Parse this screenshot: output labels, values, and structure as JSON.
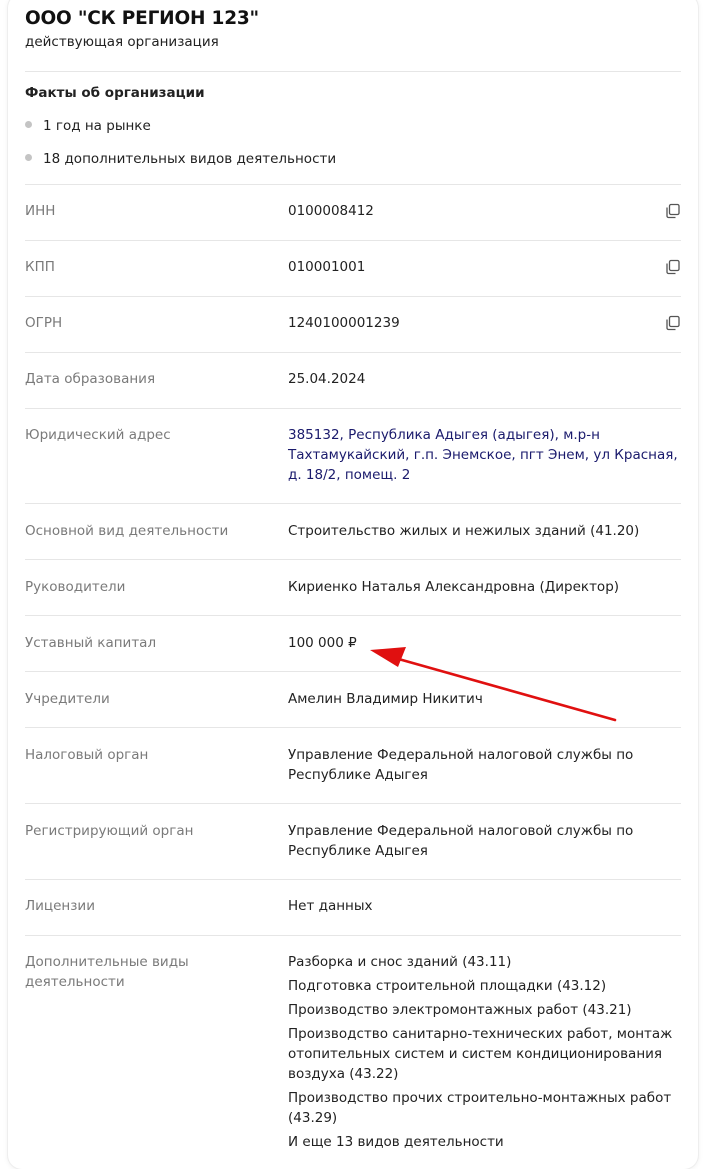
{
  "org": {
    "name": "ООО \"СК РЕГИОН 123\"",
    "status": "действующая организация"
  },
  "facts": {
    "title": "Факты об организации",
    "items": [
      "1 год на рынке",
      "18 дополнительных видов деятельности"
    ]
  },
  "rows": {
    "inn": {
      "label": "ИНН",
      "value": "0100008412"
    },
    "kpp": {
      "label": "КПП",
      "value": "010001001"
    },
    "ogrn": {
      "label": "ОГРН",
      "value": "1240100001239"
    },
    "founded": {
      "label": "Дата образования",
      "value": "25.04.2024"
    },
    "address": {
      "label": "Юридический адрес",
      "lines": [
        "385132, Республика Адыгея (адыгея), м.р-н",
        "Тахтамукайский, г.п. Энемское, пгт Энем, ул Красная,",
        "д. 18/2, помещ. 2"
      ]
    },
    "main_activity": {
      "label": "Основной вид деятельности",
      "value": "Строительство жилых и нежилых зданий (41.20)"
    },
    "managers": {
      "label": "Руководители",
      "value": "Кириенко Наталья Александровна (Директор)"
    },
    "capital": {
      "label": "Уставный капитал",
      "value": "100 000 ₽"
    },
    "founders": {
      "label": "Учредители",
      "value": "Амелин Владимир Никитич"
    },
    "tax_authority": {
      "label": "Налоговый орган",
      "lines": [
        "Управление Федеральной налоговой службы по",
        "Республике Адыгея"
      ]
    },
    "registering_authority": {
      "label": "Регистрирующий орган",
      "lines": [
        "Управление Федеральной налоговой службы по",
        "Республике Адыгея"
      ]
    },
    "licenses": {
      "label": "Лицензии",
      "value": "Нет данных"
    },
    "extra_activities": {
      "label_lines": [
        "Дополнительные виды",
        "деятельности"
      ],
      "lines": [
        "Разборка и снос зданий (43.11)",
        "Подготовка строительной площадки (43.12)",
        "Производство электромонтажных работ (43.21)",
        "Производство санитарно-технических работ, монтаж",
        "отопительных систем и систем кондиционирования",
        "воздуха (43.22)",
        "Производство прочих строительно-монтажных работ",
        "(43.29)",
        "И еще 13 видов деятельности"
      ]
    }
  },
  "icons": {
    "copy": "copy-icon",
    "arrow": "red-arrow-annotation"
  },
  "colors": {
    "label": "#7a7a7a",
    "value": "#222222",
    "address_link": "#1a1a6c",
    "arrow": "#e01010",
    "divider": "#e6e6e6",
    "bullet": "#c4c4c4"
  }
}
